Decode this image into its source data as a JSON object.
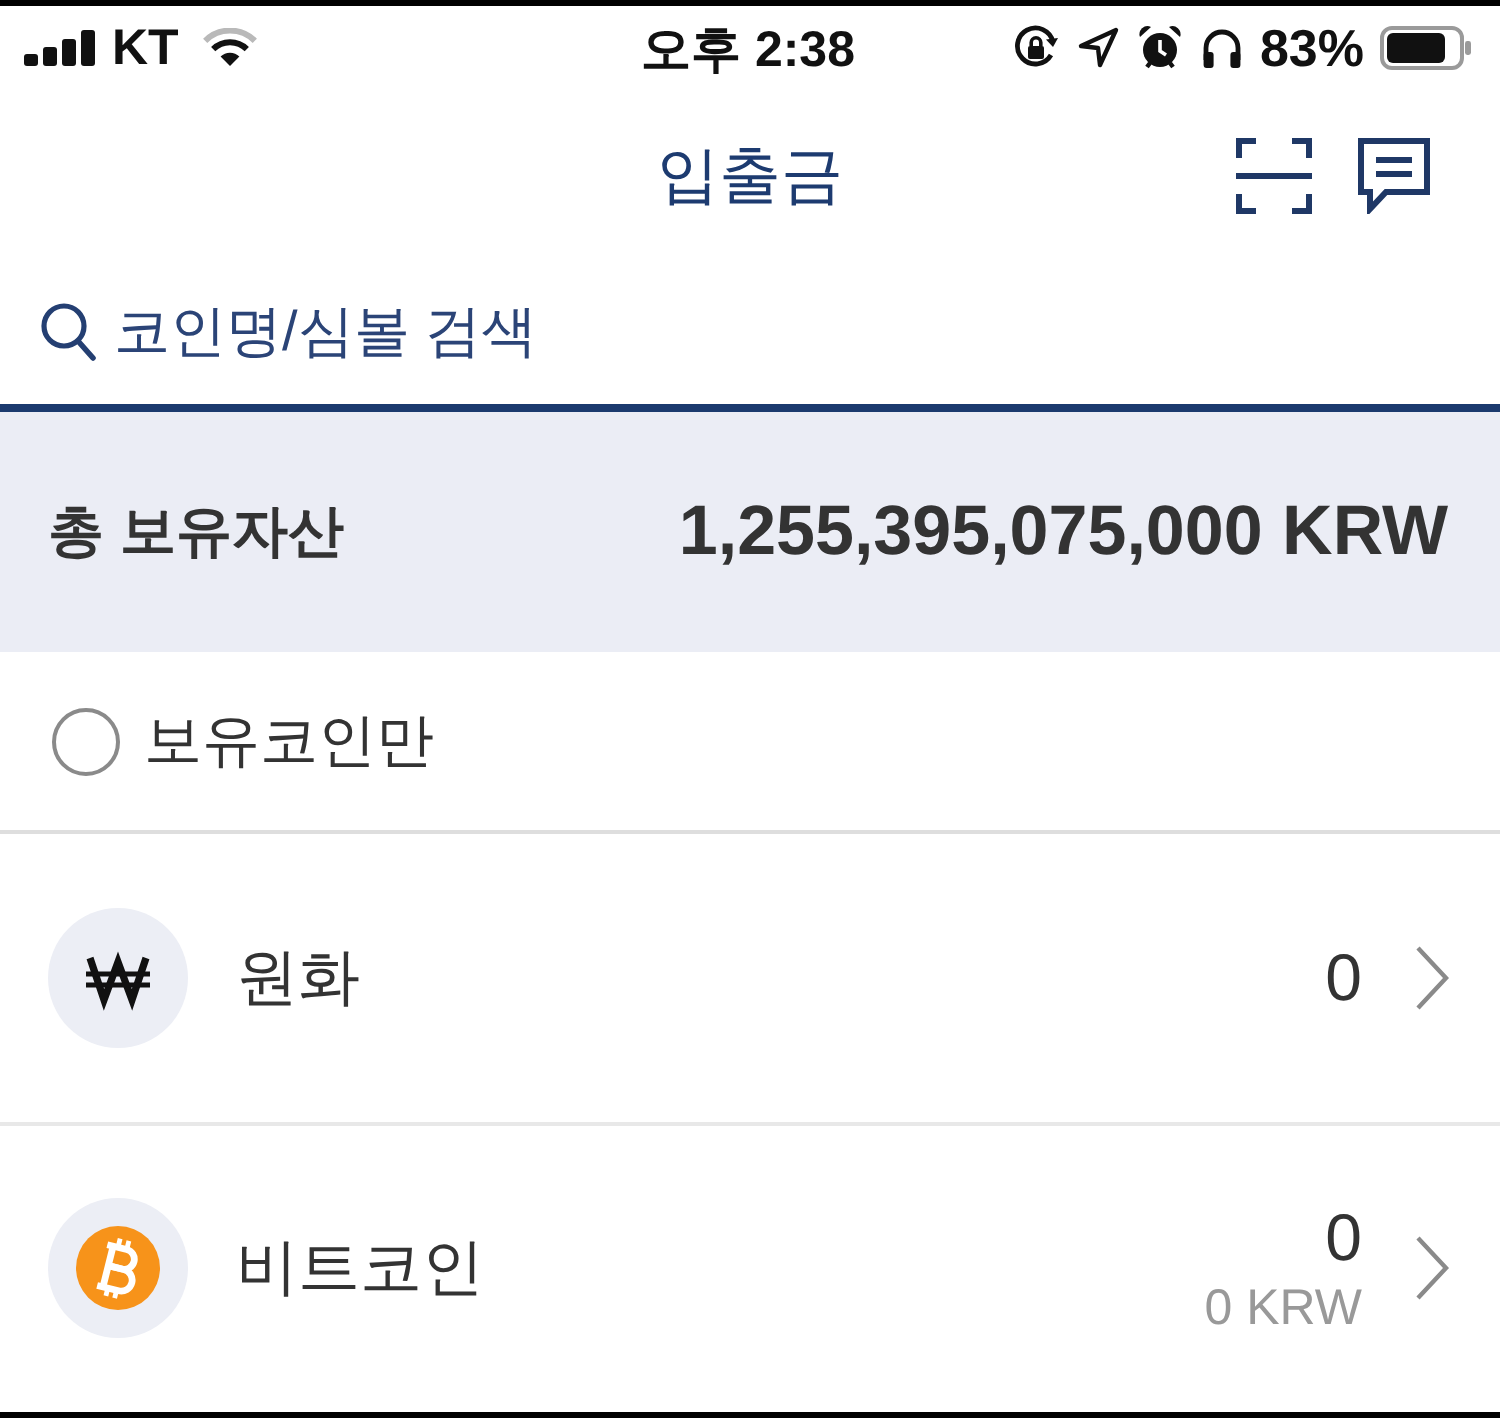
{
  "status_bar": {
    "carrier": "KT",
    "time": "오후 2:38",
    "battery": "83%"
  },
  "header": {
    "title": "입출금"
  },
  "search": {
    "placeholder": "코인명/심볼 검색"
  },
  "total": {
    "label": "총 보유자산",
    "value": "1,255,395,075,000 KRW"
  },
  "filter": {
    "label": "보유코인만",
    "checked": false
  },
  "assets": [
    {
      "kind": "won",
      "name": "원화",
      "amount": "0"
    },
    {
      "kind": "bitcoin",
      "name": "비트코인",
      "amount": "0",
      "krw_value": "0 KRW"
    }
  ]
}
